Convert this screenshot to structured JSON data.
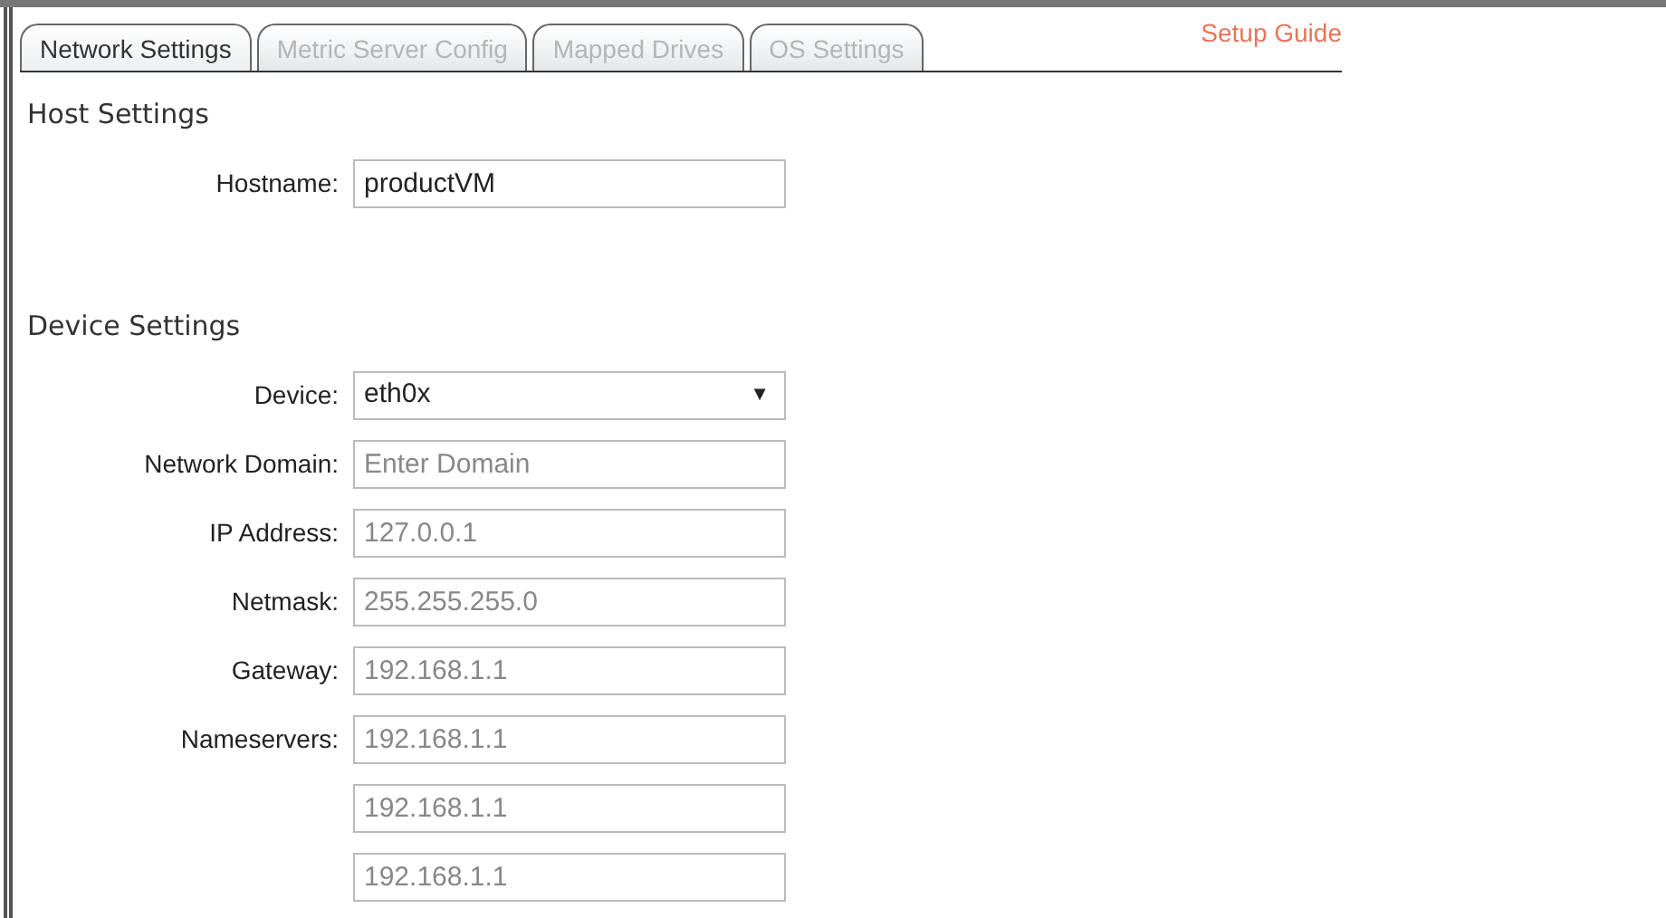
{
  "tabs": [
    {
      "label": "Network Settings",
      "selected": true
    },
    {
      "label": "Metric Server Config",
      "selected": false
    },
    {
      "label": "Mapped Drives",
      "selected": false
    },
    {
      "label": "OS Settings",
      "selected": false
    }
  ],
  "setup_guide_link": "Setup Guide",
  "sections": [
    {
      "title": "Host Settings",
      "fields": [
        {
          "kind": "text",
          "label": "Hostname:",
          "value": "productVM"
        }
      ]
    },
    {
      "title": "Device Settings",
      "fields": [
        {
          "kind": "select",
          "label": "Device:",
          "value": "eth0x",
          "caret": "▼"
        },
        {
          "kind": "text",
          "label": "Network Domain:",
          "placeholder": "Enter Domain"
        },
        {
          "kind": "text",
          "label": "IP Address:",
          "placeholder": "127.0.0.1"
        },
        {
          "kind": "text",
          "label": "Netmask:",
          "placeholder": "255.255.255.0"
        },
        {
          "kind": "text",
          "label": "Gateway:",
          "placeholder": "192.168.1.1"
        },
        {
          "kind": "text",
          "label": "Nameservers:",
          "placeholder": "192.168.1.1"
        },
        {
          "kind": "text",
          "placeholder": "192.168.1.1"
        },
        {
          "kind": "text",
          "placeholder": "192.168.1.1"
        }
      ]
    }
  ]
}
